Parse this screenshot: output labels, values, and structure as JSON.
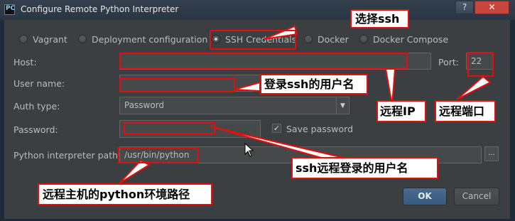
{
  "window": {
    "title": "Configure Remote Python Interpreter",
    "app_icon_text": "PC",
    "help_label": "?",
    "close_label": "✕"
  },
  "radios": [
    {
      "label": "Vagrant",
      "selected": false
    },
    {
      "label": "Deployment configuration",
      "selected": false
    },
    {
      "label": "SSH Credentials",
      "selected": true
    },
    {
      "label": "Docker",
      "selected": false
    },
    {
      "label": "Docker Compose",
      "selected": false
    }
  ],
  "form": {
    "host_label": "Host:",
    "host_value": "",
    "port_label": "Port:",
    "port_value": "22",
    "username_label": "User name:",
    "username_value": "",
    "auth_label": "Auth type:",
    "auth_value": "Password",
    "password_label": "Password:",
    "password_value": "",
    "save_password_label": "Save password",
    "save_password_checked": true,
    "interpreter_label": "Python interpreter path:",
    "interpreter_value": "/usr/bin/python",
    "browse_label": "..."
  },
  "buttons": {
    "ok": "OK",
    "cancel": "Cancel"
  },
  "annotations": {
    "choose_ssh": "选择ssh",
    "login_user": "登录ssh的用户名",
    "remote_ip": "远程IP",
    "remote_port": "远程端口",
    "ssh_password_user": "ssh远程登录的用户名",
    "python_env_path": "远程主机的python环境路径"
  },
  "colors": {
    "annotation_red": "#e01010",
    "dialog_bg": "#3c3f41",
    "ok_button": "#375a7f"
  }
}
